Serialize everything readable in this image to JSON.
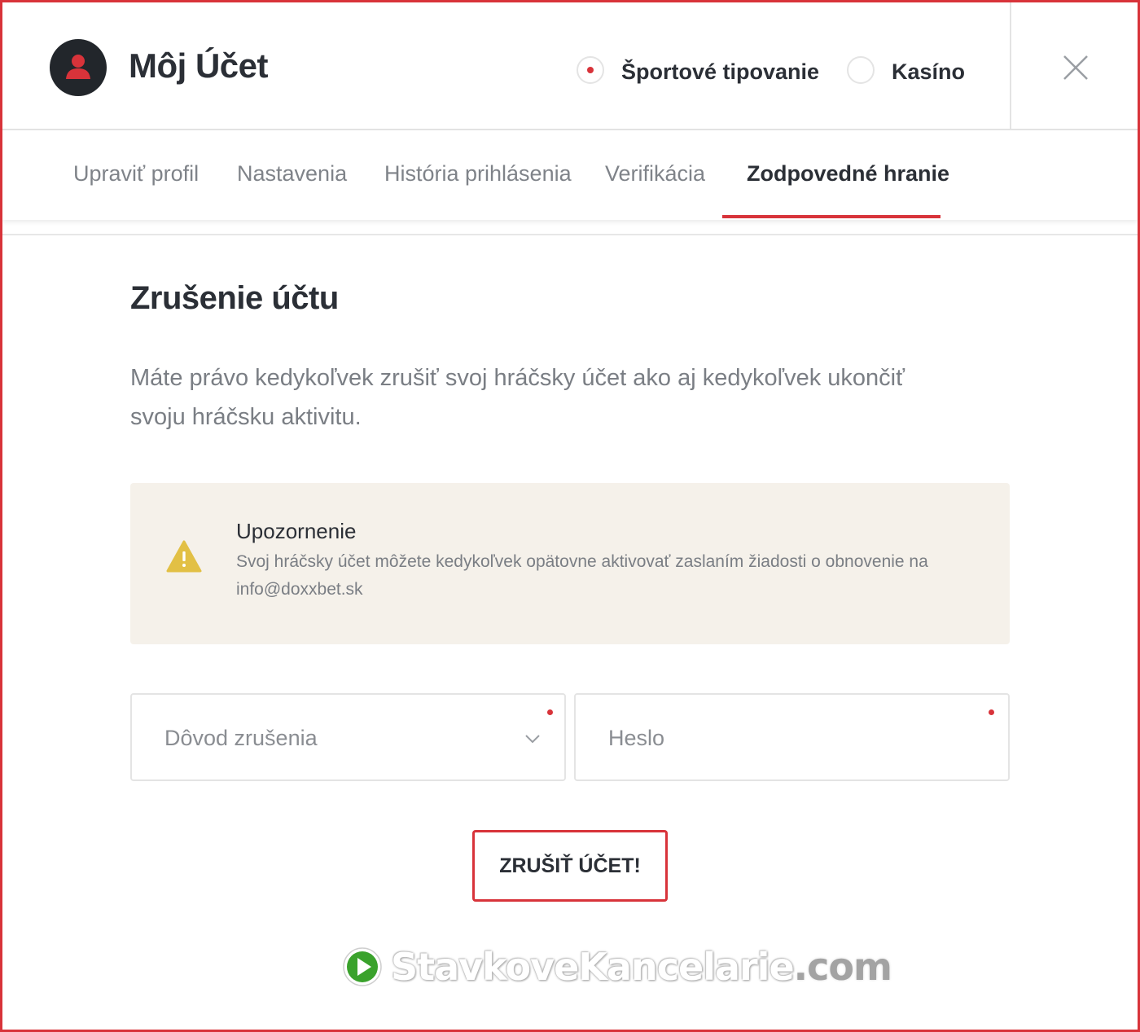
{
  "header": {
    "title": "Môj Účet",
    "avatar_icon": "user-icon",
    "modes": [
      {
        "label": "Športové tipovanie",
        "selected": true
      },
      {
        "label": "Kasíno",
        "selected": false
      }
    ],
    "close_icon": "close-icon"
  },
  "tabs": [
    {
      "label": "Upraviť profil",
      "active": false
    },
    {
      "label": "Nastavenia",
      "active": false
    },
    {
      "label": "História prihlásenia",
      "active": false
    },
    {
      "label": "Verifikácia",
      "active": false
    },
    {
      "label": "Zodpovedné hranie",
      "active": true
    }
  ],
  "content": {
    "title": "Zrušenie účtu",
    "description": "Máte právo kedykoľvek zrušiť svoj hráčsky účet ako aj kedykoľvek ukončiť svoju hráčsku aktivitu."
  },
  "alert": {
    "icon": "warning-icon",
    "title": "Upozornenie",
    "text": "Svoj hráčsky účet môžete kedykoľvek opätovne aktivovať zaslaním žiadosti o obnovenie na info@doxxbet.sk"
  },
  "form": {
    "reason_placeholder": "Dôvod zrušenia",
    "password_placeholder": "Heslo",
    "submit_label": "ZRUŠIŤ ÚČET!"
  },
  "watermark": {
    "main": "StavkoveKancelarie",
    "tld": ".com",
    "icon": "play-icon"
  },
  "colors": {
    "accent": "#d8333a",
    "text_dark": "#2b2f36",
    "text_muted": "#7a7e84",
    "alert_bg": "#f5f1ea",
    "warning": "#e2c045"
  }
}
